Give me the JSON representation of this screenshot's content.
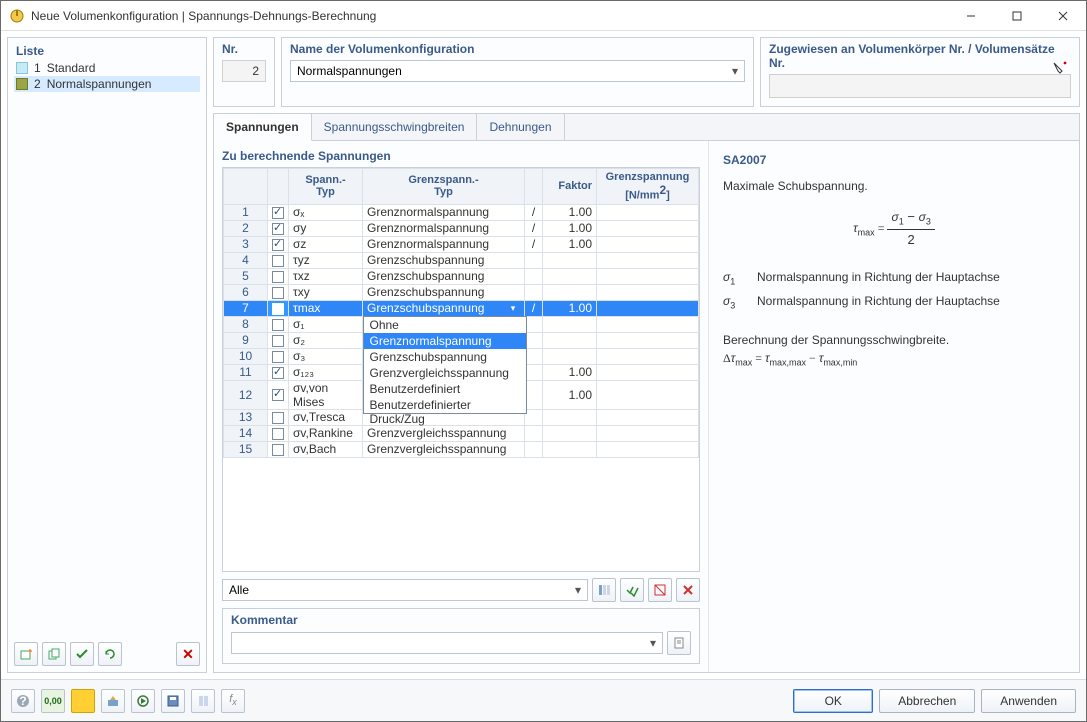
{
  "window": {
    "title": "Neue Volumenkonfiguration | Spannungs-Dehnungs-Berechnung"
  },
  "sidebar": {
    "label": "Liste",
    "items": [
      {
        "num": "1",
        "label": "Standard"
      },
      {
        "num": "2",
        "label": "Normalspannungen"
      }
    ]
  },
  "nr": {
    "label": "Nr.",
    "value": "2"
  },
  "name": {
    "label": "Name der Volumenkonfiguration",
    "value": "Normalspannungen"
  },
  "assign": {
    "label": "Zugewiesen an Volumenkörper Nr. / Volumensätze Nr."
  },
  "tabs": {
    "t1": "Spannungen",
    "t2": "Spannungsschwingbreiten",
    "t3": "Dehnungen"
  },
  "grid": {
    "title": "Zu berechnende Spannungen",
    "headers": {
      "stress": "Spann.-\nTyp",
      "limit": "Grenzspann.-\nTyp",
      "factor": "Faktor",
      "limitval": "Grenzspannung [N/mm²]"
    },
    "rows": [
      {
        "n": "1",
        "chk": true,
        "stress": "σₓ",
        "limit": "Grenznormalspannung",
        "slash": "/",
        "factor": "1.00",
        "limitval": ""
      },
      {
        "n": "2",
        "chk": true,
        "stress": "σy",
        "limit": "Grenznormalspannung",
        "slash": "/",
        "factor": "1.00",
        "limitval": ""
      },
      {
        "n": "3",
        "chk": true,
        "stress": "σz",
        "limit": "Grenznormalspannung",
        "slash": "/",
        "factor": "1.00",
        "limitval": ""
      },
      {
        "n": "4",
        "chk": false,
        "stress": "τyz",
        "limit": "Grenzschubspannung",
        "slash": "",
        "factor": "",
        "limitval": ""
      },
      {
        "n": "5",
        "chk": false,
        "stress": "τxz",
        "limit": "Grenzschubspannung",
        "slash": "",
        "factor": "",
        "limitval": ""
      },
      {
        "n": "6",
        "chk": false,
        "stress": "τxy",
        "limit": "Grenzschubspannung",
        "slash": "",
        "factor": "",
        "limitval": ""
      },
      {
        "n": "7",
        "chk": true,
        "stress": "τmax",
        "limit": "Grenzschubspannung",
        "slash": "/",
        "factor": "1.00",
        "limitval": ""
      },
      {
        "n": "8",
        "chk": false,
        "stress": "σ₁",
        "limit": "",
        "slash": "",
        "factor": "",
        "limitval": ""
      },
      {
        "n": "9",
        "chk": false,
        "stress": "σ₂",
        "limit": "",
        "slash": "",
        "factor": "",
        "limitval": ""
      },
      {
        "n": "10",
        "chk": false,
        "stress": "σ₃",
        "limit": "",
        "slash": "",
        "factor": "",
        "limitval": ""
      },
      {
        "n": "11",
        "chk": true,
        "stress": "σ₁₂₃",
        "limit": "",
        "slash": "",
        "factor": "1.00",
        "limitval": ""
      },
      {
        "n": "12",
        "chk": true,
        "stress": "σv,von Mises",
        "limit": "",
        "slash": "",
        "factor": "1.00",
        "limitval": ""
      },
      {
        "n": "13",
        "chk": false,
        "stress": "σv,Tresca",
        "limit": "",
        "slash": "",
        "factor": "",
        "limitval": ""
      },
      {
        "n": "14",
        "chk": false,
        "stress": "σv,Rankine",
        "limit": "Grenzvergleichsspannung",
        "slash": "",
        "factor": "",
        "limitval": ""
      },
      {
        "n": "15",
        "chk": false,
        "stress": "σv,Bach",
        "limit": "Grenzvergleichsspannung",
        "slash": "",
        "factor": "",
        "limitval": ""
      }
    ],
    "dropdown": {
      "options": [
        "Ohne",
        "Grenznormalspannung",
        "Grenzschubspannung",
        "Grenzvergleichsspannung",
        "Benutzerdefiniert",
        "Benutzerdefinierter Druck/Zug"
      ],
      "highlighted": 1
    },
    "filter_label": "Alle"
  },
  "info": {
    "code": "SA2007",
    "title": "Maximale Schubspannung.",
    "sigma1": "Normalspannung in Richtung der Hauptachse",
    "sigma3": "Normalspannung in Richtung der Hauptachse",
    "swing_title": "Berechnung der Spannungsschwingbreite.",
    "swing_formula": "Δτmax = τmax,max - τmax,min"
  },
  "kommentar": {
    "label": "Kommentar"
  },
  "footer": {
    "ok": "OK",
    "cancel": "Abbrechen",
    "apply": "Anwenden"
  }
}
